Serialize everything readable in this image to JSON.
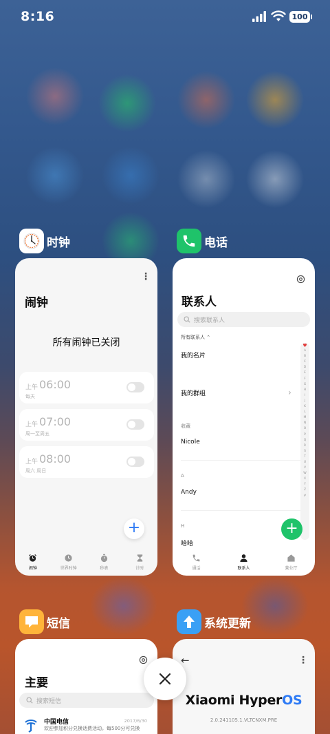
{
  "status_bar": {
    "time": "8:16",
    "battery": "100"
  },
  "recents": {
    "clock": {
      "app_name": "时钟",
      "title": "闹钟",
      "empty_message": "所有闹钟已关闭",
      "alarms": [
        {
          "ampm": "上午",
          "time": "06:00",
          "repeat": "每天",
          "enabled": false
        },
        {
          "ampm": "上午",
          "time": "07:00",
          "repeat": "周一至周五",
          "enabled": false
        },
        {
          "ampm": "上午",
          "time": "08:00",
          "repeat": "周六 周日",
          "enabled": false
        }
      ],
      "tabs": [
        "闹钟",
        "世界时钟",
        "秒表",
        "计时"
      ],
      "fab": "+"
    },
    "phone": {
      "app_name": "电话",
      "title": "联系人",
      "search_placeholder": "搜索联系人",
      "all_contacts": "所有联系人 ⌃",
      "my_card": "我的名片",
      "my_groups": "我的群组",
      "favorites_header": "收藏",
      "favorite_1": "Nicole",
      "section_a": "A",
      "contact_a": "Andy",
      "section_h": "H",
      "contact_h": "哈哈",
      "index": [
        "♥",
        "A",
        "B",
        "C",
        "D",
        "E",
        "F",
        "G",
        "H",
        "I",
        "J",
        "K",
        "L",
        "M",
        "N",
        "O",
        "P",
        "Q",
        "R",
        "S",
        "T",
        "U",
        "V",
        "W",
        "X",
        "Y",
        "Z",
        "#"
      ],
      "tabs": [
        "通话",
        "联系人",
        "营业厅"
      ],
      "fab": "+"
    },
    "sms": {
      "app_name": "短信",
      "title": "主要",
      "search_placeholder": "搜索短信",
      "message": {
        "sender": "中国电信",
        "date": "2017/6/30",
        "preview": "欢迎参加积分兑换话费活动，每500分可兑换"
      }
    },
    "update": {
      "app_name": "系统更新",
      "title_main": "Xiaomi Hyper",
      "title_os": "OS",
      "version": "2.0.241105.1.VLTCNXM.PRE"
    }
  },
  "colors": {
    "accent_blue": "#2f7bf5",
    "accent_green": "#1fc36a"
  }
}
